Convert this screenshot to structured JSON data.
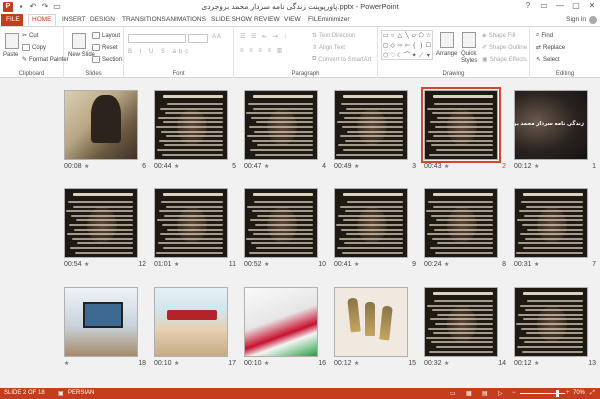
{
  "window": {
    "title": "پاورپوینت زندگی نامه سردار محمد بروجردی.pptx - PowerPoint",
    "controls": [
      "?",
      "▭",
      "—",
      "▢",
      "✕"
    ]
  },
  "tabs": [
    "FILE",
    "HOME",
    "INSERT",
    "DESIGN",
    "TRANSITIONS",
    "ANIMATIONS",
    "SLIDE SHOW",
    "REVIEW",
    "VIEW",
    "FILEminimizer"
  ],
  "account": {
    "signin": "Sign in"
  },
  "ribbon": {
    "clipboard": {
      "label": "Clipboard",
      "paste": "Paste",
      "cut": "Cut",
      "copy": "Copy",
      "format_painter": "Format Painter"
    },
    "slides": {
      "label": "Slides",
      "new_slide": "New Slide",
      "layout": "Layout",
      "reset": "Reset",
      "section": "Section"
    },
    "font": {
      "label": "Font"
    },
    "paragraph": {
      "label": "Paragraph",
      "text_direction": "Text Direction",
      "align_text": "Align Text",
      "smartart": "Convert to SmartArt"
    },
    "drawing": {
      "label": "Drawing",
      "arrange": "Arrange",
      "quick_styles": "Quick Styles",
      "shape_fill": "Shape Fill",
      "shape_outline": "Shape Outline",
      "shape_effects": "Shape Effects"
    },
    "editing": {
      "label": "Editing",
      "find": "Find",
      "replace": "Replace",
      "select": "Select"
    }
  },
  "slides": [
    {
      "number": "1",
      "time": "00:12",
      "kind": "title",
      "title": "زندگی نامه سردار محمد بروجردی"
    },
    {
      "number": "2",
      "time": "00:43",
      "kind": "text",
      "selected": true
    },
    {
      "number": "3",
      "time": "00:49",
      "kind": "text"
    },
    {
      "number": "4",
      "time": "00:47",
      "kind": "text"
    },
    {
      "number": "5",
      "time": "00:44",
      "kind": "text"
    },
    {
      "number": "6",
      "time": "00:08",
      "kind": "photo"
    },
    {
      "number": "7",
      "time": "00:31",
      "kind": "text"
    },
    {
      "number": "8",
      "time": "00:24",
      "kind": "text"
    },
    {
      "number": "9",
      "time": "00:41",
      "kind": "text"
    },
    {
      "number": "10",
      "time": "00:52",
      "kind": "text"
    },
    {
      "number": "11",
      "time": "01:01",
      "kind": "text"
    },
    {
      "number": "12",
      "time": "00:54",
      "kind": "text"
    },
    {
      "number": "13",
      "time": "00:12",
      "kind": "text"
    },
    {
      "number": "14",
      "time": "00:32",
      "kind": "text"
    },
    {
      "number": "15",
      "time": "00:12",
      "kind": "bullets"
    },
    {
      "number": "16",
      "time": "00:10",
      "kind": "flag"
    },
    {
      "number": "17",
      "time": "00:10",
      "kind": "banner"
    },
    {
      "number": "18",
      "time": "",
      "kind": "laptop"
    }
  ],
  "status": {
    "slide_of": "SLIDE 2 OF 18",
    "language": "PERSIAN",
    "zoom": "70%"
  },
  "colors": {
    "accent": "#c43e1c",
    "selection": "#d24726",
    "sorter_bg": "#f1f1f1"
  }
}
